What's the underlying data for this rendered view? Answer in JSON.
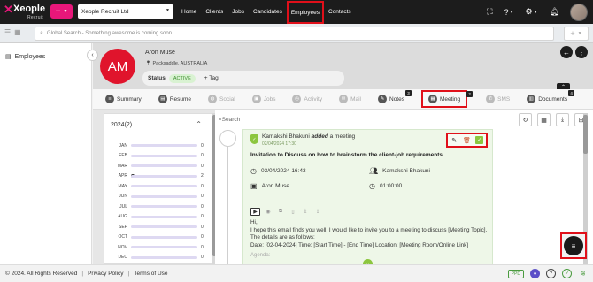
{
  "topbar": {
    "logo_text": "Xeople",
    "logo_sub": "Recruit",
    "add_symbol": "+",
    "company": "Xeople Recruit Ltd",
    "nav": [
      "Home",
      "Clients",
      "Jobs",
      "Candidates",
      "Employees",
      "Contacts"
    ],
    "active_nav": "Employees",
    "icons": [
      "fullscreen-icon",
      "help-icon",
      "gear-icon",
      "bell-icon"
    ]
  },
  "searchbar": {
    "placeholder": "Global Search - Something awesome is coming soon",
    "add_symbol": "+"
  },
  "sidebar": {
    "items": [
      {
        "label": "Employees",
        "icon": "employees-icon"
      }
    ]
  },
  "profile": {
    "initials": "AM",
    "name": "Aron Muse",
    "location": "Packsaddle, AUSTRALIA",
    "status_label": "Status",
    "status_value": "ACTIVE",
    "tag_label": "Tag"
  },
  "tabs": [
    {
      "label": "Summary",
      "count": "",
      "enabled": true
    },
    {
      "label": "Resume",
      "count": "",
      "enabled": true
    },
    {
      "label": "Social",
      "count": "",
      "enabled": false
    },
    {
      "label": "Jobs",
      "count": "",
      "enabled": false
    },
    {
      "label": "Activity",
      "count": "",
      "enabled": false
    },
    {
      "label": "Mail",
      "count": "",
      "enabled": false
    },
    {
      "label": "Notes",
      "count": "3",
      "enabled": true
    },
    {
      "label": "Meeting",
      "count": "2",
      "enabled": true,
      "active": true
    },
    {
      "label": "SMS",
      "count": "",
      "enabled": false
    },
    {
      "label": "Documents",
      "count": "4",
      "enabled": true
    }
  ],
  "year_panel": {
    "title": "2024(2)",
    "months": [
      {
        "m": "JAN",
        "n": 0
      },
      {
        "m": "FEB",
        "n": 0
      },
      {
        "m": "MAR",
        "n": 0
      },
      {
        "m": "APR",
        "n": 2
      },
      {
        "m": "MAY",
        "n": 0
      },
      {
        "m": "JUN",
        "n": 0
      },
      {
        "m": "JUL",
        "n": 0
      },
      {
        "m": "AUG",
        "n": 0
      },
      {
        "m": "SEP",
        "n": 0
      },
      {
        "m": "OCT",
        "n": 0
      },
      {
        "m": "NOV",
        "n": 0
      },
      {
        "m": "DEC",
        "n": 0
      }
    ]
  },
  "timeline": {
    "search_placeholder": "Search",
    "tools": [
      "refresh-icon",
      "calendar-icon",
      "download-icon",
      "hierarchy-icon"
    ]
  },
  "meeting": {
    "author": "Kamakshi Bhakuni",
    "action": "added",
    "object": "a meeting",
    "timestamp": "02/04/2024 17:30",
    "subject": "Invitation to Discuss on how to brainstorm the client-job requirements",
    "datetime": "03/04/2024 16:43",
    "organizer": "Kamakshi Bhakuni",
    "attendee": "Aron Muse",
    "duration": "01:00:00",
    "greeting": "Hi,",
    "message": "I hope this email finds you well. I would like to invite you to a meeting to discuss [Meeting Topic]. The details are as follows:",
    "details": "Date: [02-04-2024] Time: [Start Time] - [End Time] Location: [Meeting Room/Online Link]",
    "agenda": "Agenda:"
  },
  "footer": {
    "copyright": "© 2024. All Rights Reserved",
    "privacy": "Privacy Policy",
    "terms": "Terms of Use",
    "ppd": "PPD"
  }
}
